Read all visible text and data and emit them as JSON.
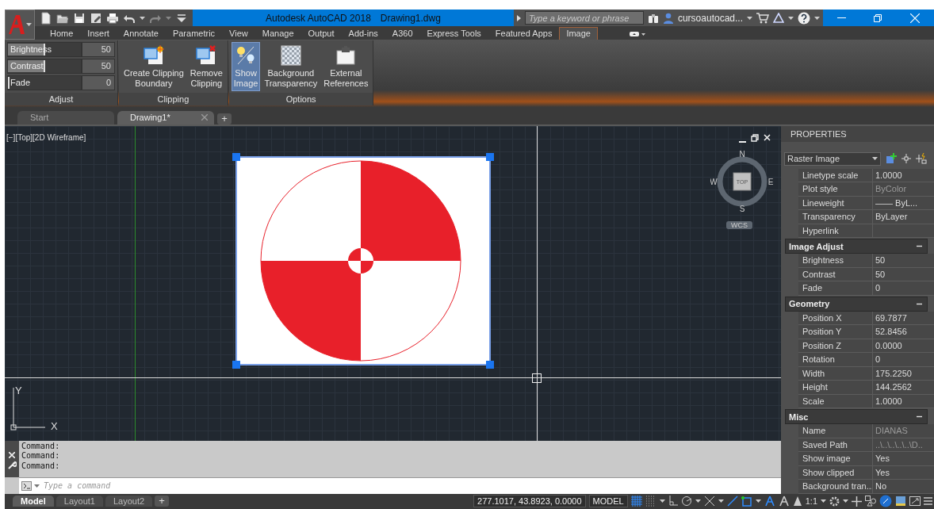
{
  "title_bar": {
    "app_name": "Autodesk AutoCAD 2018",
    "file_name": "Drawing1.dwg",
    "search": {
      "placeholder": "Type a keyword or phrase"
    },
    "user": "cursoautocad..."
  },
  "ribbon_tabs": [
    {
      "label": "Home",
      "selected": false
    },
    {
      "label": "Insert",
      "selected": false
    },
    {
      "label": "Annotate",
      "selected": false
    },
    {
      "label": "Parametric",
      "selected": false
    },
    {
      "label": "View",
      "selected": false
    },
    {
      "label": "Manage",
      "selected": false
    },
    {
      "label": "Output",
      "selected": false
    },
    {
      "label": "Add-ins",
      "selected": false
    },
    {
      "label": "A360",
      "selected": false
    },
    {
      "label": "Express Tools",
      "selected": false
    },
    {
      "label": "Featured Apps",
      "selected": false
    },
    {
      "label": "Image",
      "selected": true
    }
  ],
  "ribbon_panels": [
    {
      "title": "Adjust",
      "kind": "sliders",
      "sliders": [
        {
          "label": "Brightness",
          "value": "50",
          "level": 0.5
        },
        {
          "label": "Contrast",
          "value": "50",
          "level": 0.5
        },
        {
          "label": "Fade",
          "value": "0",
          "level": 0
        }
      ]
    },
    {
      "title": "Clipping",
      "kind": "buttons",
      "buttons": [
        {
          "lines": [
            "Create Clipping",
            "Boundary"
          ],
          "selected": false
        },
        {
          "lines": [
            "Remove",
            "Clipping"
          ],
          "selected": false
        }
      ]
    },
    {
      "title": "Options",
      "kind": "buttons",
      "buttons": [
        {
          "lines": [
            "Show",
            "Image"
          ],
          "selected": true
        },
        {
          "lines": [
            "Background",
            "Transparency"
          ],
          "selected": false
        },
        {
          "lines": [
            "External",
            "References"
          ],
          "selected": false
        }
      ]
    }
  ],
  "doc_tabs": [
    {
      "label": "Start",
      "selected": false
    },
    {
      "label": "Drawing1*",
      "selected": true
    }
  ],
  "new_tab": "+",
  "viewport": {
    "label": "[−][Top][2D Wireframe]",
    "compass": {
      "n": "N",
      "s": "S",
      "e": "E",
      "w": "W",
      "face": "TOP"
    },
    "ucs_menu": "WCS",
    "axis_x": "X",
    "axis_y": "Y"
  },
  "properties": {
    "title": "PROPERTIES",
    "selection": "Raster Image",
    "rows": [
      {
        "label": "Linetype scale",
        "value": "1.0000",
        "disabled": false
      },
      {
        "label": "Plot style",
        "value": "ByColor",
        "disabled": true
      },
      {
        "label": "Lineweight",
        "value": "—— ByL...",
        "disabled": false
      },
      {
        "label": "Transparency",
        "value": "ByLayer",
        "disabled": false
      },
      {
        "label": "Hyperlink"
      }
    ],
    "sections": [
      {
        "title": "Image Adjust",
        "expanded": true,
        "rows": [
          {
            "label": "Brightness",
            "value": "50",
            "disabled": false
          },
          {
            "label": "Contrast",
            "value": "50",
            "disabled": false
          },
          {
            "label": "Fade",
            "value": "0",
            "disabled": false
          }
        ]
      },
      {
        "title": "Geometry",
        "expanded": true,
        "rows": [
          {
            "label": "Position X",
            "value": "69.7877",
            "disabled": false
          },
          {
            "label": "Position Y",
            "value": "52.8456",
            "disabled": false
          },
          {
            "label": "Position Z",
            "value": "0.0000",
            "disabled": false
          },
          {
            "label": "Rotation",
            "value": "0",
            "disabled": false
          },
          {
            "label": "Width",
            "value": "175.2250",
            "disabled": false
          },
          {
            "label": "Height",
            "value": "144.2562",
            "disabled": false
          },
          {
            "label": "Scale",
            "value": "1.0000",
            "disabled": false
          }
        ]
      },
      {
        "title": "Misc",
        "expanded": true,
        "rows": [
          {
            "label": "Name",
            "value": "DIANAS",
            "disabled": true
          },
          {
            "label": "Saved Path",
            "value": "..\\..\\..\\..\\..\\D...",
            "disabled": true
          },
          {
            "label": "Show image",
            "value": "Yes",
            "disabled": false
          },
          {
            "label": "Show clipped",
            "value": "Yes",
            "disabled": false
          },
          {
            "label": "Background  tran...",
            "value": "No",
            "disabled": false
          }
        ]
      }
    ]
  },
  "command": {
    "history": [
      "Command:",
      "Command:",
      "Command:"
    ],
    "input": {
      "placeholder": "Type a command"
    }
  },
  "layout_tabs": [
    {
      "label": "Model",
      "selected": true
    },
    {
      "label": "Layout1",
      "selected": false
    },
    {
      "label": "Layout2",
      "selected": false
    }
  ],
  "new_layout": "+",
  "status_bar": {
    "coordinates": "277.1017, 43.8923, 0.0000",
    "space": "MODEL",
    "scale": "1:1"
  }
}
